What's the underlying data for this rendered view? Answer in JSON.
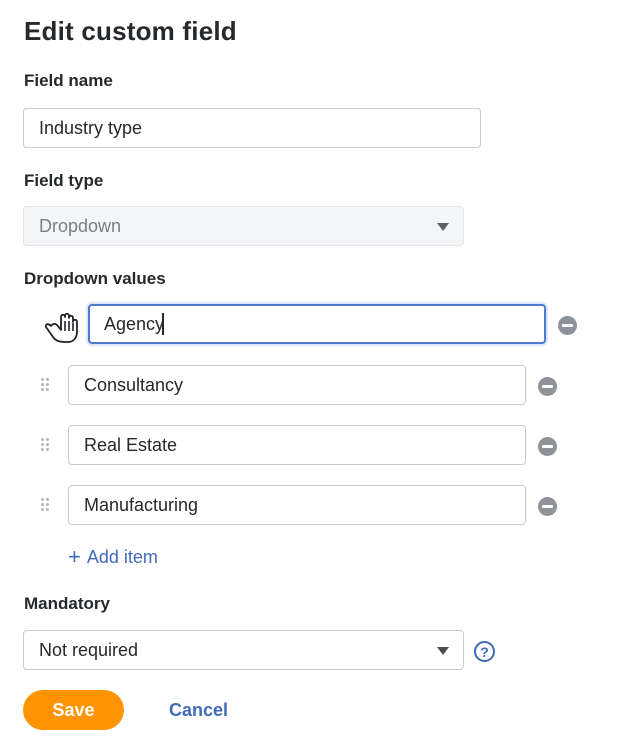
{
  "page": {
    "title": "Edit custom field"
  },
  "field_name": {
    "label": "Field name",
    "value": "Industry type"
  },
  "field_type": {
    "label": "Field type",
    "value": "Dropdown",
    "disabled": true
  },
  "dropdown_values": {
    "label": "Dropdown values",
    "items": [
      {
        "value": "Agency",
        "state": "focused, being dragged"
      },
      {
        "value": "Consultancy"
      },
      {
        "value": "Real Estate"
      },
      {
        "value": "Manufacturing"
      }
    ],
    "add_item_label": "Add item"
  },
  "mandatory": {
    "label": "Mandatory",
    "value": "Not required",
    "help_icon": "?"
  },
  "actions": {
    "save_label": "Save",
    "cancel_label": "Cancel"
  },
  "colors": {
    "accent_blue": "#3f6bb7",
    "focus_border": "#4c7bd1",
    "save_orange": "#ff9400",
    "remove_grey": "#8e9399"
  },
  "icons": {
    "drag": "drag-handle-icon",
    "remove": "remove-circle-icon",
    "add": "plus-icon",
    "help": "help-circle-icon",
    "cursor": "grab-hand-cursor-icon"
  }
}
